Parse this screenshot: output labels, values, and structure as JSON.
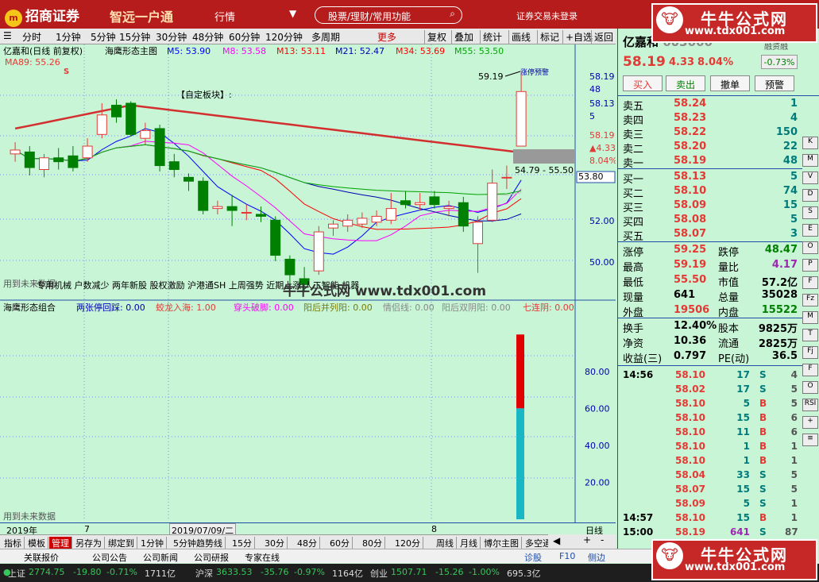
{
  "titlebar": {
    "logo": "招商证券",
    "logo_icon": "m",
    "slogan": "智远一户通",
    "menu": "行情",
    "search_placeholder": "股票/理财/常用功能",
    "account": "证券交易未登录"
  },
  "watermark": {
    "title": "牛牛公式网",
    "url": "www.tdx001.com",
    "mid_text": "牛牛公式网 www.tdx001.com"
  },
  "toolbar": {
    "left": [
      "分时",
      "1分钟",
      "5分钟",
      "15分钟",
      "30分钟",
      "48分钟",
      "60分钟",
      "120分钟",
      "多周期",
      "更多"
    ],
    "right": [
      "复权",
      "叠加",
      "统计",
      "画线",
      "标记",
      "+自选",
      "返回"
    ]
  },
  "main_header": {
    "stock": "亿嘉和(日线 前复权)",
    "indicator": "海鹰形态主图",
    "ma": [
      {
        "label": "M5: 53.90",
        "color": "#0000ff"
      },
      {
        "label": "M8: 53.58",
        "color": "#ff00ff"
      },
      {
        "label": "M13: 53.11",
        "color": "#ff0000"
      },
      {
        "label": "M21: 52.47",
        "color": "#0000b0"
      },
      {
        "label": "M34: 53.69",
        "color": "#ff0000"
      },
      {
        "label": "M55: 53.50",
        "color": "#00aa00"
      }
    ],
    "ma89": "MA89: 55.26",
    "s_mark": "S"
  },
  "main_chart": {
    "custom_block": "【自定板块】:",
    "annot_high": "59.19",
    "annot_range": "54.79 - 55.50",
    "annot_label": "涨停预警",
    "bottom_text": "用到未来数据",
    "concept_text": "专用机械 户数减少 两年新股 股权激励 沪港通SH 上周强势 近期上涨 人工智能 机器",
    "right_axis": [
      "58.19",
      "48",
      "58.13",
      "5",
      "58.19",
      "▲4.33",
      "8.04%",
      "53.80",
      "52.00",
      "50.00"
    ]
  },
  "chart_data": [
    {
      "type": "candlestick",
      "title": "亿嘉和(日线 前复权)",
      "ylim": [
        49,
        60
      ],
      "candles": [
        {
          "o": 55.0,
          "c": 55.2,
          "h": 55.6,
          "l": 54.6
        },
        {
          "o": 55.1,
          "c": 54.3,
          "h": 55.4,
          "l": 53.9
        },
        {
          "o": 54.2,
          "c": 54.8,
          "h": 55.0,
          "l": 53.8
        },
        {
          "o": 54.8,
          "c": 54.6,
          "h": 55.3,
          "l": 54.2
        },
        {
          "o": 54.9,
          "c": 54.3,
          "h": 55.4,
          "l": 54.1
        },
        {
          "o": 54.8,
          "c": 55.4,
          "h": 55.8,
          "l": 54.6
        },
        {
          "o": 56.0,
          "c": 57.0,
          "h": 57.6,
          "l": 55.8
        },
        {
          "o": 57.5,
          "c": 56.9,
          "h": 57.8,
          "l": 56.6
        },
        {
          "o": 57.6,
          "c": 56.0,
          "h": 57.7,
          "l": 55.9
        },
        {
          "o": 55.8,
          "c": 56.2,
          "h": 56.6,
          "l": 55.5
        },
        {
          "o": 56.3,
          "c": 54.4,
          "h": 56.5,
          "l": 54.1
        },
        {
          "o": 54.6,
          "c": 54.2,
          "h": 55.0,
          "l": 53.8
        },
        {
          "o": 53.8,
          "c": 53.6,
          "h": 54.0,
          "l": 53.1
        },
        {
          "o": 53.6,
          "c": 52.1,
          "h": 53.8,
          "l": 51.9
        },
        {
          "o": 52.2,
          "c": 52.3,
          "h": 52.6,
          "l": 51.9
        },
        {
          "o": 52.3,
          "c": 52.1,
          "h": 52.9,
          "l": 51.3
        },
        {
          "o": 52.0,
          "c": 52.0,
          "h": 52.4,
          "l": 51.6
        },
        {
          "o": 51.9,
          "c": 51.8,
          "h": 52.3,
          "l": 51.5
        },
        {
          "o": 51.6,
          "c": 49.8,
          "h": 51.8,
          "l": 49.5
        },
        {
          "o": 49.6,
          "c": 48.8,
          "h": 49.8,
          "l": 48.3
        },
        {
          "o": 48.6,
          "c": 48.3,
          "h": 49.2,
          "l": 47.9
        },
        {
          "o": 49.0,
          "c": 51.0,
          "h": 51.3,
          "l": 48.8
        },
        {
          "o": 51.2,
          "c": 51.4,
          "h": 51.6,
          "l": 50.8
        },
        {
          "o": 51.3,
          "c": 51.6,
          "h": 51.9,
          "l": 51.0
        },
        {
          "o": 51.4,
          "c": 51.7,
          "h": 52.0,
          "l": 51.2
        },
        {
          "o": 51.5,
          "c": 51.8,
          "h": 52.1,
          "l": 51.3
        },
        {
          "o": 51.6,
          "c": 52.2,
          "h": 53.0,
          "l": 51.4
        },
        {
          "o": 52.6,
          "c": 52.4,
          "h": 53.1,
          "l": 52.2
        },
        {
          "o": 52.4,
          "c": 52.5,
          "h": 53.0,
          "l": 52.1
        },
        {
          "o": 52.8,
          "c": 52.4,
          "h": 53.1,
          "l": 52.2
        },
        {
          "o": 52.2,
          "c": 52.3,
          "h": 52.6,
          "l": 51.8
        },
        {
          "o": 52.5,
          "c": 51.3,
          "h": 52.8,
          "l": 51.0
        },
        {
          "o": 50.4,
          "c": 51.5,
          "h": 51.8,
          "l": 48.9
        },
        {
          "o": 51.6,
          "c": 53.5,
          "h": 54.2,
          "l": 51.5
        },
        {
          "o": 53.8,
          "c": 53.8,
          "h": 54.4,
          "l": 53.2
        },
        {
          "o": 55.4,
          "c": 58.2,
          "h": 59.2,
          "l": 55.4
        }
      ]
    },
    {
      "type": "bar",
      "title": "海鹰形态组合",
      "ylim": [
        0,
        110
      ],
      "series": [
        {
          "name": "red",
          "values": [
            100
          ]
        },
        {
          "name": "cyan",
          "values": [
            60
          ]
        }
      ],
      "yticks": [
        20,
        40,
        60,
        80
      ]
    }
  ],
  "sub_header": {
    "name": "海鹰形态组合",
    "items": [
      {
        "label": "两张停回踩: 0.00",
        "color": "#0000b0"
      },
      {
        "label": "蛟龙入海: 1.00",
        "color": "#e53935"
      },
      {
        "label": "穿头破脚: 0.00",
        "color": "#ff00ff"
      },
      {
        "label": "阳后并列阳: 0.00",
        "color": "#7b7b00"
      },
      {
        "label": "情侣线: 0.00",
        "color": "#888888"
      },
      {
        "label": "阳后双阴阳: 0.00",
        "color": "#888888"
      },
      {
        "label": "七连阴: 0.00",
        "color": "#e53935"
      }
    ],
    "bottom_text": "用到未来数据",
    "axis": [
      "80.00",
      "60.00",
      "40.00",
      "20.00"
    ]
  },
  "time_axis": {
    "year": "2019年",
    "month1": "7",
    "date": "2019/07/09/二",
    "month2": "8",
    "period": "日线"
  },
  "bottombar": [
    "指标",
    "模板",
    "管理",
    "另存为",
    "绑定到",
    "1分钟",
    "5分钟趋势线",
    "15分",
    "30分",
    "48分",
    "60分",
    "80分",
    "120分",
    "周线",
    "月线",
    "博尔主图",
    "多空通道"
  ],
  "statusbar": {
    "items": [
      "关联报价",
      "公司公告",
      "公司新闻",
      "公司研报",
      "专家在线"
    ],
    "right": [
      "诊股",
      "F10",
      "侧边"
    ]
  },
  "indexbar": [
    {
      "name": "上证",
      "value": "2774.75",
      "chg": "-19.80",
      "pct": "-0.71%",
      "vol": "1711亿"
    },
    {
      "name": "沪深",
      "value": "3633.53",
      "chg": "-35.76",
      "pct": "-0.97%",
      "vol": "1164亿"
    },
    {
      "name": "创业",
      "value": "1507.71",
      "chg": "-15.26",
      "pct": "-1.00%",
      "vol": "695.3亿"
    }
  ],
  "quote": {
    "name": "亿嘉和",
    "code_partial": "603666",
    "price": "58.19",
    "chg": "4.33",
    "pct": "8.04%",
    "side_pct": "-0.73%",
    "side_label": "融资融",
    "buttons": [
      "买入",
      "卖出",
      "撤单",
      "预警"
    ],
    "asks": [
      {
        "label": "卖五",
        "price": "58.24",
        "vol": "1"
      },
      {
        "label": "卖四",
        "price": "58.23",
        "vol": "4"
      },
      {
        "label": "卖三",
        "price": "58.22",
        "vol": "150"
      },
      {
        "label": "卖二",
        "price": "58.20",
        "vol": "22"
      },
      {
        "label": "卖一",
        "price": "58.19",
        "vol": "48"
      }
    ],
    "bids": [
      {
        "label": "买一",
        "price": "58.13",
        "vol": "5"
      },
      {
        "label": "买二",
        "price": "58.10",
        "vol": "74"
      },
      {
        "label": "买三",
        "price": "58.09",
        "vol": "15"
      },
      {
        "label": "买四",
        "price": "58.08",
        "vol": "5"
      },
      {
        "label": "买五",
        "price": "58.07",
        "vol": "3"
      }
    ],
    "stats": [
      {
        "k1": "涨停",
        "v1": "59.25",
        "c1": "red",
        "k2": "跌停",
        "v2": "48.47",
        "c2": "grn"
      },
      {
        "k1": "最高",
        "v1": "59.19",
        "c1": "red",
        "k2": "量比",
        "v2": "4.17",
        "c2": "pur"
      },
      {
        "k1": "最低",
        "v1": "55.50",
        "c1": "red",
        "k2": "市值",
        "v2": "57.2亿",
        "c2": "blk"
      },
      {
        "k1": "现量",
        "v1": "641",
        "c1": "blk",
        "k2": "总量",
        "v2": "35028",
        "c2": "blk"
      },
      {
        "k1": "外盘",
        "v1": "19506",
        "c1": "red",
        "k2": "内盘",
        "v2": "15522",
        "c2": "grn"
      }
    ],
    "stats2": [
      {
        "k1": "换手",
        "v1": "12.40%",
        "k2": "股本",
        "v2": "9825万"
      },
      {
        "k1": "净资",
        "v1": "10.36",
        "k2": "流通",
        "v2": "2825万"
      },
      {
        "k1": "收益(三)",
        "v1": "0.797",
        "k2": "PE(动)",
        "v2": "36.5"
      }
    ],
    "ticks": [
      {
        "t": "14:56",
        "p": "58.10",
        "v": "17",
        "bs": "S",
        "n": "4"
      },
      {
        "t": "",
        "p": "58.02",
        "v": "17",
        "bs": "S",
        "n": "5"
      },
      {
        "t": "",
        "p": "58.10",
        "v": "5",
        "bs": "B",
        "n": "5"
      },
      {
        "t": "",
        "p": "58.10",
        "v": "15",
        "bs": "B",
        "n": "6"
      },
      {
        "t": "",
        "p": "58.10",
        "v": "11",
        "bs": "B",
        "n": "6"
      },
      {
        "t": "",
        "p": "58.10",
        "v": "1",
        "bs": "B",
        "n": "1"
      },
      {
        "t": "",
        "p": "58.10",
        "v": "1",
        "bs": "B",
        "n": "1"
      },
      {
        "t": "",
        "p": "58.04",
        "v": "33",
        "bs": "S",
        "n": "5"
      },
      {
        "t": "",
        "p": "58.07",
        "v": "15",
        "bs": "S",
        "n": "5"
      },
      {
        "t": "",
        "p": "58.09",
        "v": "5",
        "bs": "S",
        "n": "1"
      },
      {
        "t": "14:57",
        "p": "58.10",
        "v": "15",
        "bs": "B",
        "n": "1"
      },
      {
        "t": "15:00",
        "p": "58.19",
        "v": "641",
        "bs": "S",
        "n": "87"
      }
    ]
  },
  "side_icons": [
    "K",
    "M",
    "V",
    "D",
    "S",
    "E",
    "O",
    "P",
    "F",
    "Fz",
    "M",
    "T",
    "Fj",
    "F",
    "O",
    "RSI",
    "+",
    "≡"
  ],
  "colors": {
    "bg": "#c8f5d6",
    "up": "#e53935",
    "down": "#008000",
    "axis": "#1f4ea8"
  }
}
